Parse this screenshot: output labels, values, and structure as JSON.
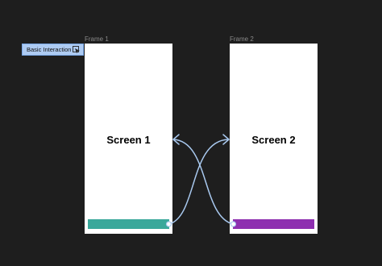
{
  "flow": {
    "label": "Basic Interaction",
    "icon": "play-flow-icon"
  },
  "frames": [
    {
      "label": "Frame 1",
      "title": "Screen 1",
      "bar_color": "#3aa89b"
    },
    {
      "label": "Frame 2",
      "title": "Screen 2",
      "bar_color": "#8e2fb0"
    }
  ],
  "colors": {
    "canvas": "#1e1e1e",
    "frame_label": "#8a8a8a",
    "connector": "#a9c9ef",
    "badge_bg": "#aecbf2"
  }
}
